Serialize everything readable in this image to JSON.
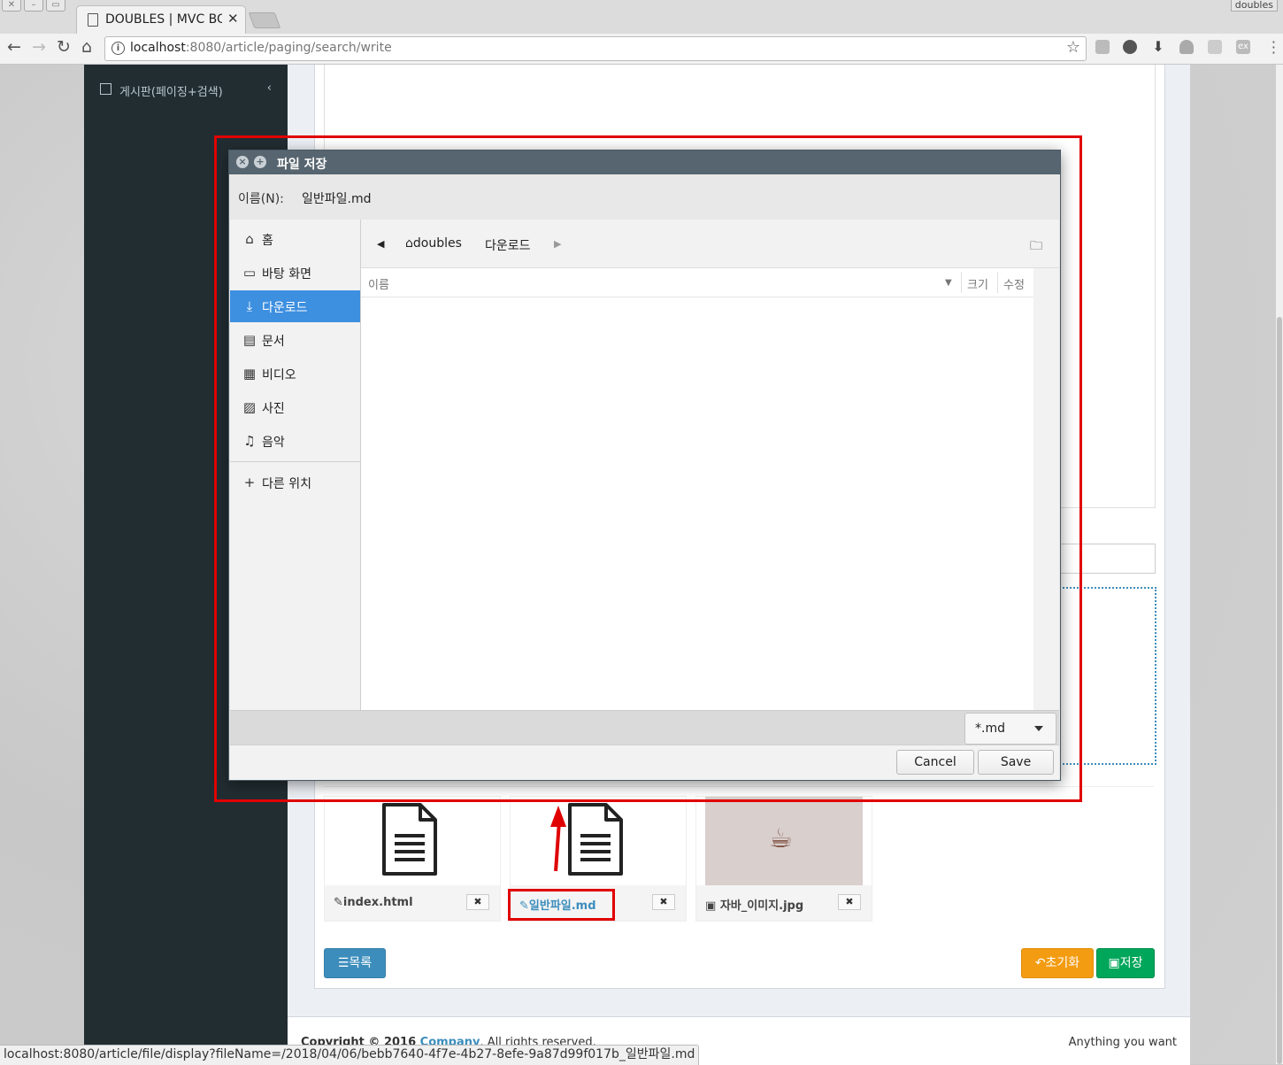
{
  "browser": {
    "tab_title": "DOUBLES | MVC BOARD",
    "profile_name": "doubles",
    "url_host": "localhost",
    "url_rest": ":8080/article/paging/search/write"
  },
  "sidebar": {
    "items": [
      {
        "label": "게시판(페이징+검색)",
        "icon": "edit-icon"
      }
    ]
  },
  "attachments": [
    {
      "name": "index.html",
      "icon": "paperclip-icon",
      "type": "document",
      "link": false
    },
    {
      "name": "일반파일.md",
      "icon": "paperclip-icon",
      "type": "document",
      "link": true
    },
    {
      "name": "자바_이미지.jpg",
      "icon": "camera-icon",
      "type": "image",
      "link": false
    }
  ],
  "buttons": {
    "list": "목록",
    "reset": "초기화",
    "save": "저장",
    "delete": "✖"
  },
  "footer": {
    "copyright_prefix": "Copyright © 2016 ",
    "company": "Company",
    "rights": ". All rights reserved.",
    "right_text": "Anything you want"
  },
  "status_url": "localhost:8080/article/file/display?fileName=/2018/04/06/bebb7640-4f7e-4b27-8efe-9a87d99f017b_일반파일.md",
  "dialog": {
    "title": "파일 저장",
    "name_label": "이름(N):",
    "name_value": "일반파일.md",
    "places": [
      {
        "label": "홈",
        "icon": "home-icon"
      },
      {
        "label": "바탕 화면",
        "icon": "desktop-icon"
      },
      {
        "label": "다운로드",
        "icon": "download-icon",
        "active": true
      },
      {
        "label": "문서",
        "icon": "document-icon"
      },
      {
        "label": "비디오",
        "icon": "video-icon"
      },
      {
        "label": "사진",
        "icon": "picture-icon"
      },
      {
        "label": "음악",
        "icon": "music-icon"
      },
      {
        "label": "다른 위치",
        "icon": "plus-icon"
      }
    ],
    "path": [
      "doubles",
      "다운로드"
    ],
    "columns": {
      "name": "이름",
      "size": "크기",
      "modified": "수정"
    },
    "filter": "*.md",
    "cancel": "Cancel",
    "save": "Save"
  },
  "colors": {
    "annotation_red": "#e00000",
    "selection_blue": "#3d8fe0",
    "sidebar_dark": "#222d32",
    "dialog_header": "#56656f"
  }
}
